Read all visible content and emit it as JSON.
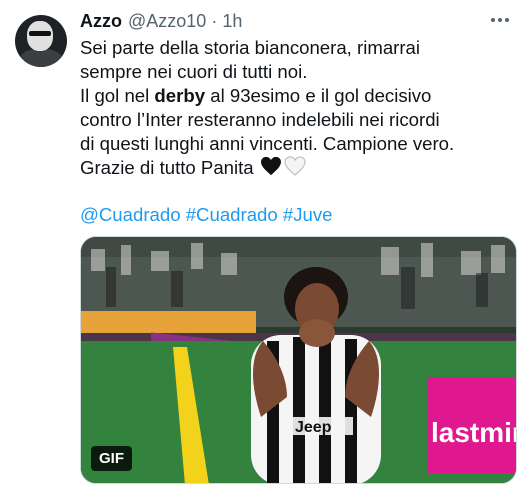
{
  "tweet": {
    "author_name": "Azzo",
    "handle": "@Azzo10",
    "separator": "·",
    "time": "1h",
    "lines": [
      "Sei parte della storia bianconera, rimarrai",
      "sempre nei cuori di tutti noi.",
      "Il gol nel ",
      "derby",
      " al 93esimo e il gol decisivo",
      "contro l’Inter resteranno indelebili nei ricordi",
      "di questi lunghi anni vincenti. Campione vero.",
      "Grazie di tutto Panita"
    ],
    "hashtags": [
      "@Cuadrado",
      "#Cuadrado",
      "#Juve"
    ],
    "media": {
      "badge": "GIF",
      "banner_text": "lastmin"
    }
  },
  "colors": {
    "link": "#1d9bf0",
    "secondary_text": "#536471",
    "primary_text": "#0f1419"
  },
  "icons": [
    "more-icon",
    "black-heart-icon",
    "white-heart-icon"
  ]
}
